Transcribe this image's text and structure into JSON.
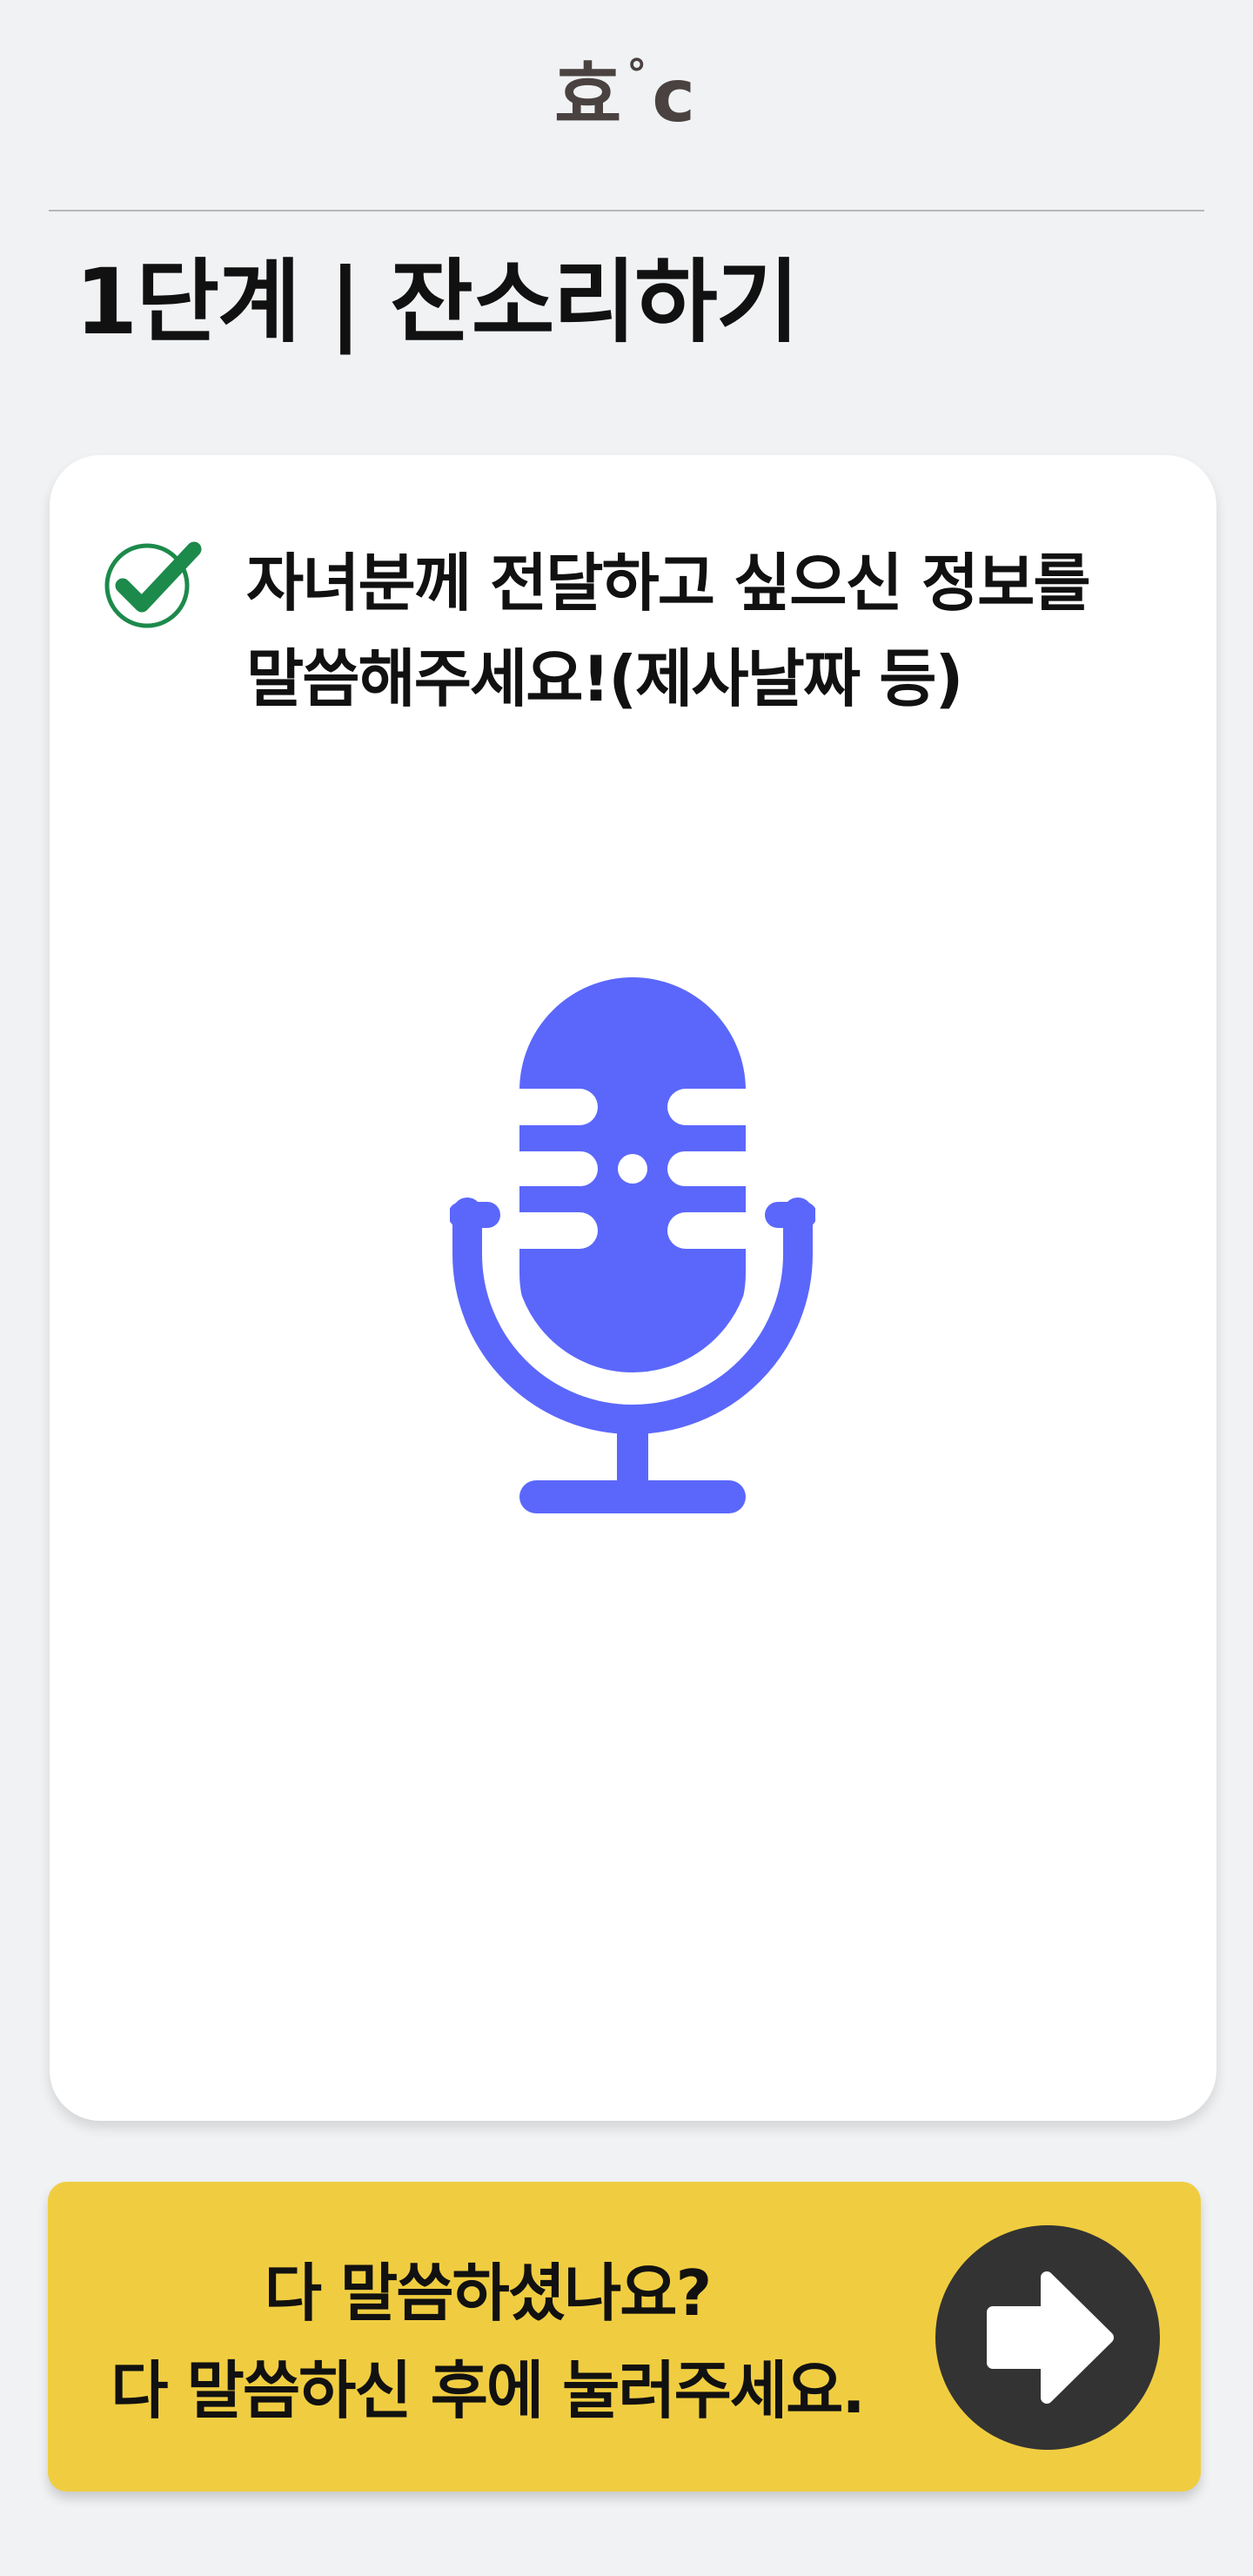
{
  "header": {
    "logo_main": "효",
    "logo_degree": "°",
    "logo_c": "c"
  },
  "page": {
    "title": "1단계 | 잔소리하기"
  },
  "card": {
    "check_icon": "check-circle-icon",
    "instruction_line1": "자녀분께 전달하고 싶으신 정보를",
    "instruction_line2": "말씀해주세요!(제사날짜 등)",
    "mic_icon": "microphone-icon",
    "mic_color": "#5b67fb",
    "check_color": "#1c8a4b"
  },
  "footer": {
    "line1": "다 말씀하셨나요?",
    "line2": "다 말씀하신 후에 눌러주세요.",
    "button_icon": "arrow-right-icon",
    "panel_color": "#f0cd40"
  }
}
